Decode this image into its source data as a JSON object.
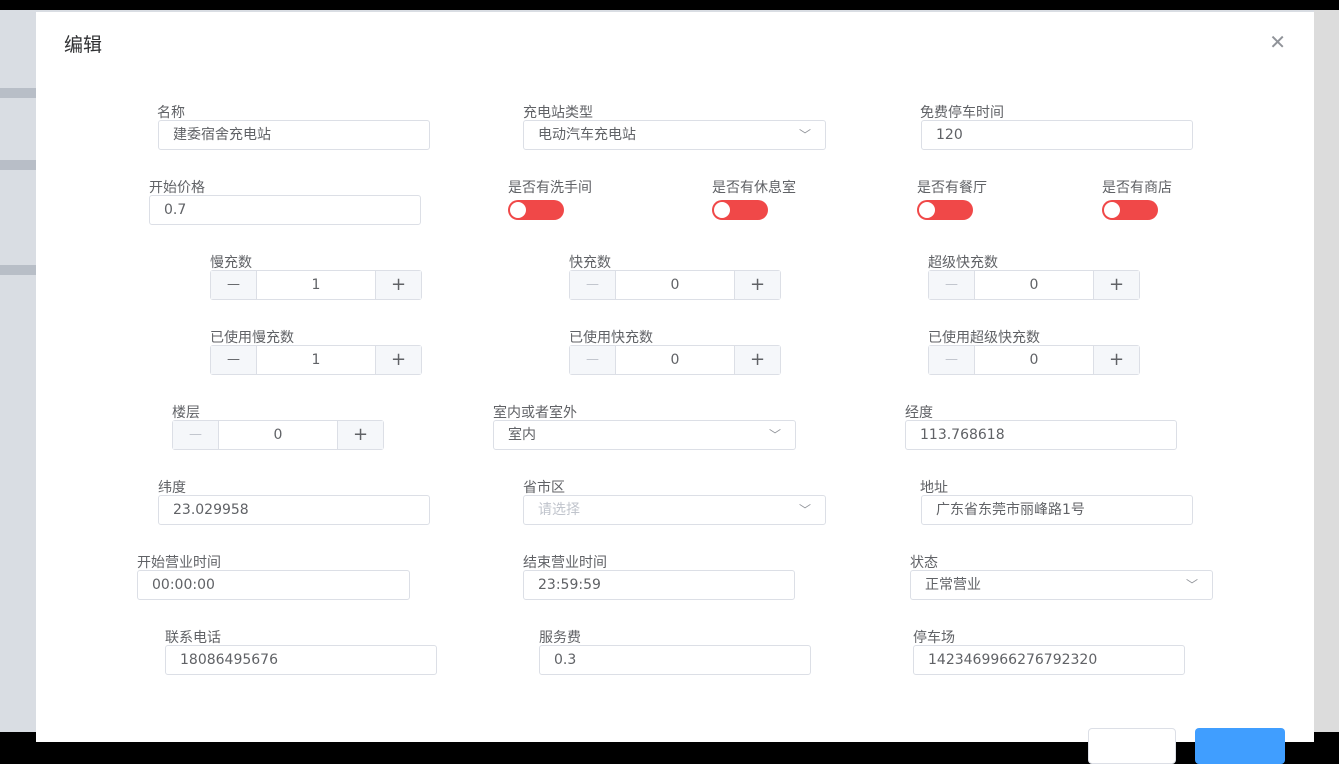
{
  "dialog": {
    "title": "编辑",
    "close_icon": "close-icon"
  },
  "colors": {
    "toggle_off": "#f04848",
    "primary": "#409eff"
  },
  "fields": [
    {
      "key": "name",
      "label": "名称",
      "type": "input",
      "value": "建委宿舍充电站"
    },
    {
      "key": "station_type",
      "label": "充电站类型",
      "type": "select",
      "value": "电动汽车充电站"
    },
    {
      "key": "free_parking",
      "label": "免费停车时间",
      "type": "input",
      "value": "120"
    },
    {
      "key": "start_price",
      "label": "开始价格",
      "type": "input",
      "value": "0.7"
    },
    {
      "key": "has_toilet",
      "label": "是否有洗手间",
      "type": "toggle",
      "value": false
    },
    {
      "key": "has_lounge",
      "label": "是否有休息室",
      "type": "toggle",
      "value": false
    },
    {
      "key": "has_restaurant",
      "label": "是否有餐厅",
      "type": "toggle",
      "value": false
    },
    {
      "key": "has_shop",
      "label": "是否有商店",
      "type": "toggle",
      "value": false
    },
    {
      "key": "slow_count",
      "label": "慢充数",
      "type": "stepper",
      "value": "1"
    },
    {
      "key": "fast_count",
      "label": "快充数",
      "type": "stepper",
      "value": "0"
    },
    {
      "key": "super_count",
      "label": "超级快充数",
      "type": "stepper",
      "value": "0"
    },
    {
      "key": "used_slow",
      "label": "已使用慢充数",
      "type": "stepper",
      "value": "1"
    },
    {
      "key": "used_fast",
      "label": "已使用快充数",
      "type": "stepper",
      "value": "0"
    },
    {
      "key": "used_super",
      "label": "已使用超级快充数",
      "type": "stepper",
      "value": "0"
    },
    {
      "key": "floor",
      "label": "楼层",
      "type": "stepper",
      "value": "0"
    },
    {
      "key": "indoor",
      "label": "室内或者室外",
      "type": "select",
      "value": "室内"
    },
    {
      "key": "longitude",
      "label": "经度",
      "type": "input",
      "value": "113.768618"
    },
    {
      "key": "latitude",
      "label": "纬度",
      "type": "input",
      "value": "23.029958"
    },
    {
      "key": "region",
      "label": "省市区",
      "type": "select",
      "value": "",
      "placeholder": "请选择"
    },
    {
      "key": "address",
      "label": "地址",
      "type": "input",
      "value": "广东省东莞市丽峰路1号"
    },
    {
      "key": "open_time",
      "label": "开始营业时间",
      "type": "input",
      "value": "00:00:00"
    },
    {
      "key": "close_time",
      "label": "结束营业时间",
      "type": "input",
      "value": "23:59:59"
    },
    {
      "key": "status",
      "label": "状态",
      "type": "select",
      "value": "正常营业"
    },
    {
      "key": "phone",
      "label": "联系电话",
      "type": "input",
      "value": "18086495676"
    },
    {
      "key": "service_fee",
      "label": "服务费",
      "type": "input",
      "value": "0.3"
    },
    {
      "key": "parking_lot",
      "label": "停车场",
      "type": "input",
      "value": "1423469966276792320"
    }
  ]
}
